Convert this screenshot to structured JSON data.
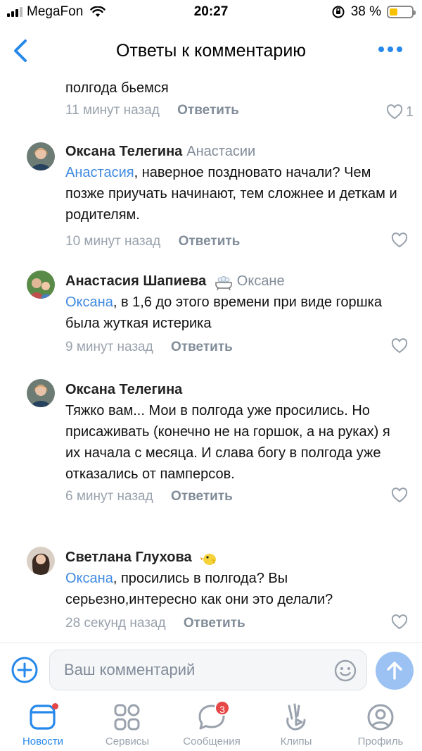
{
  "status_bar": {
    "carrier": "MegaFon",
    "time": "20:27",
    "battery": "38 %",
    "battery_level": 0.38
  },
  "header": {
    "title": "Ответы к комментарию",
    "back_icon": "chevron-left-icon",
    "more_icon": "more-horizontal-icon"
  },
  "comments": [
    {
      "author": "",
      "reply_to": "",
      "text": "полгода бьемся",
      "mention": "",
      "time": "11 минут назад",
      "reply_label": "Ответить",
      "likes": "1"
    },
    {
      "author": "Оксана Телегина",
      "reply_to": "Анастасии",
      "mention": "Анастасия",
      "text": ",  наверное поздновато начали? Чем позже приучать начинают, тем сложнее и деткам и родителям.",
      "time": "10 минут назад",
      "reply_label": "Ответить",
      "likes": ""
    },
    {
      "author": "Анастасия Шапиева",
      "reply_to": "Оксане",
      "mention": "Оксана",
      "text": ", в 1,6 до этого времени при виде горшка была жуткая истерика",
      "time": "9 минут назад",
      "reply_label": "Ответить",
      "likes": ""
    },
    {
      "author": "Оксана Телегина",
      "reply_to": "",
      "mention": "",
      "text": "Тяжко вам... Мои в полгода уже просились. Но присаживать (конечно не на горшок, а на руках) я их начала с месяца. И слава богу в полгода уже отказались от памперсов.",
      "time": "6 минут назад",
      "reply_label": "Ответить",
      "likes": ""
    },
    {
      "author": "Светлана Глухова",
      "reply_to": "",
      "mention": "Оксана",
      "text": ", просились в полгода? Вы серьезно,интересно как они это делали?",
      "time": "28 секунд назад",
      "reply_label": "Ответить",
      "likes": ""
    }
  ],
  "composer": {
    "placeholder": "Ваш комментарий"
  },
  "tabs": [
    {
      "label": "Новости",
      "icon": "news-icon",
      "active": true
    },
    {
      "label": "Сервисы",
      "icon": "services-icon",
      "active": false
    },
    {
      "label": "Сообщения",
      "icon": "messages-icon",
      "active": false,
      "badge": "3"
    },
    {
      "label": "Клипы",
      "icon": "clips-icon",
      "active": false
    },
    {
      "label": "Профиль",
      "icon": "profile-icon",
      "active": false
    }
  ],
  "colors": {
    "accent": "#2688eb",
    "mention": "#3f8ae0",
    "secondary_text": "#818c99",
    "badge": "#e64646"
  }
}
